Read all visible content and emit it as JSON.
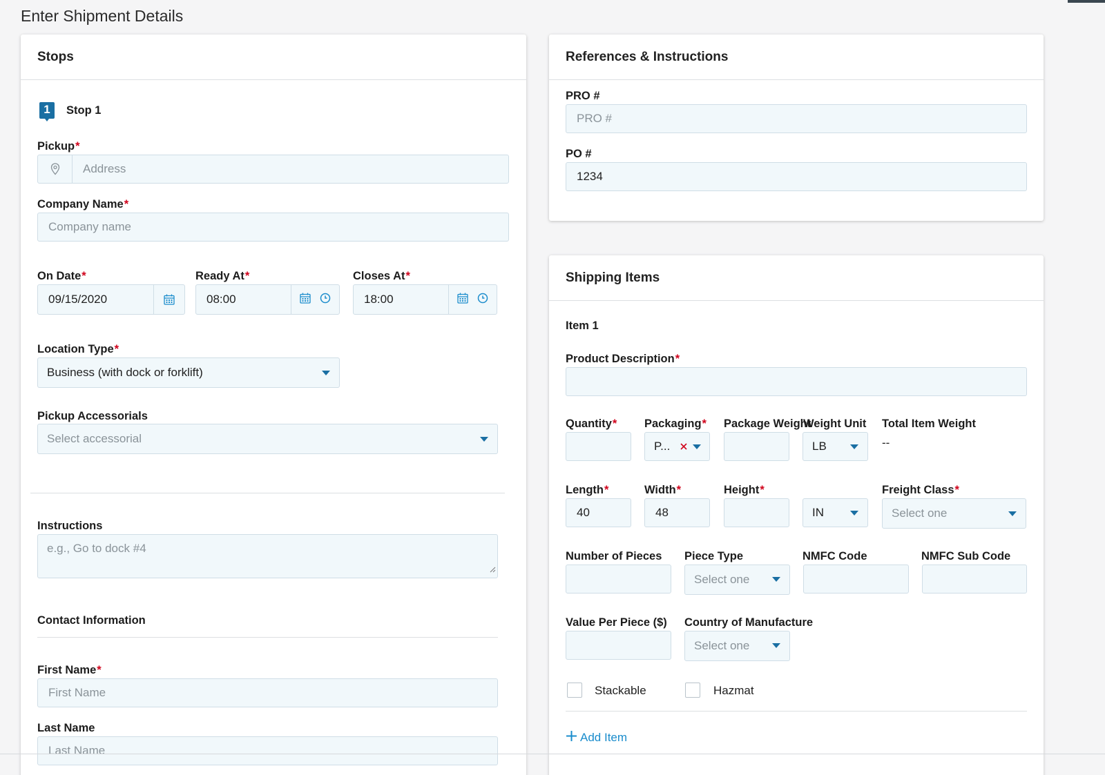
{
  "page": {
    "title": "Enter Shipment Details"
  },
  "stops": {
    "header": "Stops",
    "stop_number": "1",
    "stop_label": "Stop 1",
    "pickup": {
      "label": "Pickup",
      "placeholder": "Address"
    },
    "company": {
      "label": "Company Name",
      "placeholder": "Company name"
    },
    "on_date": {
      "label": "On Date",
      "value": "09/15/2020"
    },
    "ready_at": {
      "label": "Ready At",
      "value": "08:00"
    },
    "closes_at": {
      "label": "Closes At",
      "value": "18:00"
    },
    "location_type": {
      "label": "Location Type",
      "value": "Business (with dock or forklift)"
    },
    "accessorials": {
      "label": "Pickup Accessorials",
      "placeholder": "Select accessorial"
    },
    "instructions": {
      "label": "Instructions",
      "placeholder": "e.g., Go to dock #4"
    },
    "contact_heading": "Contact Information",
    "first_name": {
      "label": "First Name",
      "placeholder": "First Name"
    },
    "last_name": {
      "label": "Last Name",
      "placeholder": "Last Name"
    }
  },
  "references": {
    "header": "References & Instructions",
    "pro": {
      "label": "PRO #",
      "placeholder": "PRO #"
    },
    "po": {
      "label": "PO #",
      "value": "1234"
    }
  },
  "items": {
    "header": "Shipping Items",
    "item_title": "Item 1",
    "product_description": {
      "label": "Product Description",
      "value": ""
    },
    "quantity": {
      "label": "Quantity",
      "value": ""
    },
    "packaging": {
      "label": "Packaging",
      "value": "P..."
    },
    "package_weight": {
      "label": "Package Weight",
      "value": ""
    },
    "weight_unit": {
      "label": "Weight Unit",
      "value": "LB"
    },
    "total_item_weight": {
      "label": "Total Item Weight",
      "value": "--"
    },
    "length": {
      "label": "Length",
      "value": "40"
    },
    "width": {
      "label": "Width",
      "value": "48"
    },
    "height": {
      "label": "Height",
      "value": ""
    },
    "dimension_unit": {
      "value": "IN"
    },
    "freight_class": {
      "label": "Freight Class",
      "placeholder": "Select one"
    },
    "number_of_pieces": {
      "label": "Number of Pieces",
      "value": ""
    },
    "piece_type": {
      "label": "Piece Type",
      "placeholder": "Select one"
    },
    "nmfc_code": {
      "label": "NMFC Code",
      "value": ""
    },
    "nmfc_sub_code": {
      "label": "NMFC Sub Code",
      "value": ""
    },
    "value_per_piece": {
      "label": "Value Per Piece ($)",
      "value": ""
    },
    "country": {
      "label": "Country of Manufacture",
      "placeholder": "Select one"
    },
    "stackable": {
      "label": "Stackable",
      "checked": false
    },
    "hazmat": {
      "label": "Hazmat",
      "checked": false
    },
    "add_item": "Add Item"
  },
  "colors": {
    "accent": "#1a6fa3",
    "required": "#d0021b",
    "field_bg": "#f1f8fb"
  }
}
